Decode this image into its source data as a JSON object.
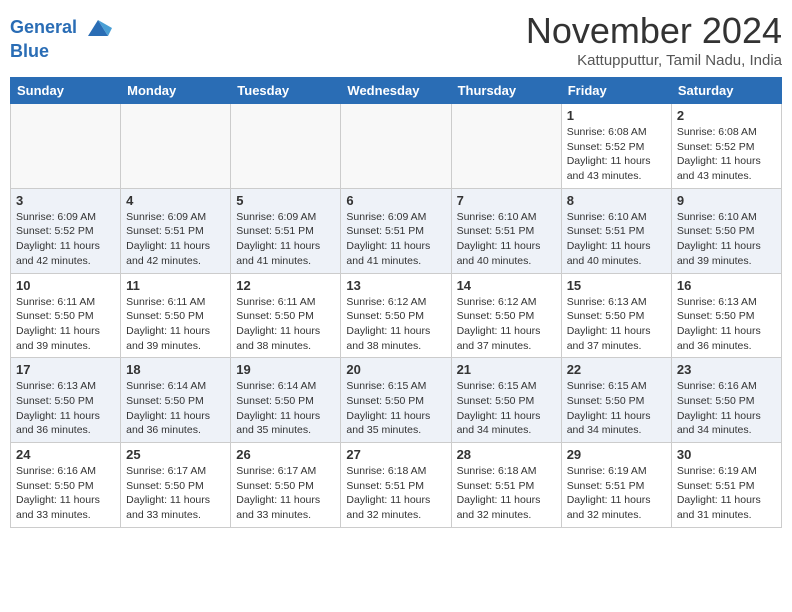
{
  "header": {
    "logo_line1": "General",
    "logo_line2": "Blue",
    "month": "November 2024",
    "location": "Kattupputtur, Tamil Nadu, India"
  },
  "weekdays": [
    "Sunday",
    "Monday",
    "Tuesday",
    "Wednesday",
    "Thursday",
    "Friday",
    "Saturday"
  ],
  "weeks": [
    [
      {
        "day": "",
        "info": ""
      },
      {
        "day": "",
        "info": ""
      },
      {
        "day": "",
        "info": ""
      },
      {
        "day": "",
        "info": ""
      },
      {
        "day": "",
        "info": ""
      },
      {
        "day": "1",
        "info": "Sunrise: 6:08 AM\nSunset: 5:52 PM\nDaylight: 11 hours and 43 minutes."
      },
      {
        "day": "2",
        "info": "Sunrise: 6:08 AM\nSunset: 5:52 PM\nDaylight: 11 hours and 43 minutes."
      }
    ],
    [
      {
        "day": "3",
        "info": "Sunrise: 6:09 AM\nSunset: 5:52 PM\nDaylight: 11 hours and 42 minutes."
      },
      {
        "day": "4",
        "info": "Sunrise: 6:09 AM\nSunset: 5:51 PM\nDaylight: 11 hours and 42 minutes."
      },
      {
        "day": "5",
        "info": "Sunrise: 6:09 AM\nSunset: 5:51 PM\nDaylight: 11 hours and 41 minutes."
      },
      {
        "day": "6",
        "info": "Sunrise: 6:09 AM\nSunset: 5:51 PM\nDaylight: 11 hours and 41 minutes."
      },
      {
        "day": "7",
        "info": "Sunrise: 6:10 AM\nSunset: 5:51 PM\nDaylight: 11 hours and 40 minutes."
      },
      {
        "day": "8",
        "info": "Sunrise: 6:10 AM\nSunset: 5:51 PM\nDaylight: 11 hours and 40 minutes."
      },
      {
        "day": "9",
        "info": "Sunrise: 6:10 AM\nSunset: 5:50 PM\nDaylight: 11 hours and 39 minutes."
      }
    ],
    [
      {
        "day": "10",
        "info": "Sunrise: 6:11 AM\nSunset: 5:50 PM\nDaylight: 11 hours and 39 minutes."
      },
      {
        "day": "11",
        "info": "Sunrise: 6:11 AM\nSunset: 5:50 PM\nDaylight: 11 hours and 39 minutes."
      },
      {
        "day": "12",
        "info": "Sunrise: 6:11 AM\nSunset: 5:50 PM\nDaylight: 11 hours and 38 minutes."
      },
      {
        "day": "13",
        "info": "Sunrise: 6:12 AM\nSunset: 5:50 PM\nDaylight: 11 hours and 38 minutes."
      },
      {
        "day": "14",
        "info": "Sunrise: 6:12 AM\nSunset: 5:50 PM\nDaylight: 11 hours and 37 minutes."
      },
      {
        "day": "15",
        "info": "Sunrise: 6:13 AM\nSunset: 5:50 PM\nDaylight: 11 hours and 37 minutes."
      },
      {
        "day": "16",
        "info": "Sunrise: 6:13 AM\nSunset: 5:50 PM\nDaylight: 11 hours and 36 minutes."
      }
    ],
    [
      {
        "day": "17",
        "info": "Sunrise: 6:13 AM\nSunset: 5:50 PM\nDaylight: 11 hours and 36 minutes."
      },
      {
        "day": "18",
        "info": "Sunrise: 6:14 AM\nSunset: 5:50 PM\nDaylight: 11 hours and 36 minutes."
      },
      {
        "day": "19",
        "info": "Sunrise: 6:14 AM\nSunset: 5:50 PM\nDaylight: 11 hours and 35 minutes."
      },
      {
        "day": "20",
        "info": "Sunrise: 6:15 AM\nSunset: 5:50 PM\nDaylight: 11 hours and 35 minutes."
      },
      {
        "day": "21",
        "info": "Sunrise: 6:15 AM\nSunset: 5:50 PM\nDaylight: 11 hours and 34 minutes."
      },
      {
        "day": "22",
        "info": "Sunrise: 6:15 AM\nSunset: 5:50 PM\nDaylight: 11 hours and 34 minutes."
      },
      {
        "day": "23",
        "info": "Sunrise: 6:16 AM\nSunset: 5:50 PM\nDaylight: 11 hours and 34 minutes."
      }
    ],
    [
      {
        "day": "24",
        "info": "Sunrise: 6:16 AM\nSunset: 5:50 PM\nDaylight: 11 hours and 33 minutes."
      },
      {
        "day": "25",
        "info": "Sunrise: 6:17 AM\nSunset: 5:50 PM\nDaylight: 11 hours and 33 minutes."
      },
      {
        "day": "26",
        "info": "Sunrise: 6:17 AM\nSunset: 5:50 PM\nDaylight: 11 hours and 33 minutes."
      },
      {
        "day": "27",
        "info": "Sunrise: 6:18 AM\nSunset: 5:51 PM\nDaylight: 11 hours and 32 minutes."
      },
      {
        "day": "28",
        "info": "Sunrise: 6:18 AM\nSunset: 5:51 PM\nDaylight: 11 hours and 32 minutes."
      },
      {
        "day": "29",
        "info": "Sunrise: 6:19 AM\nSunset: 5:51 PM\nDaylight: 11 hours and 32 minutes."
      },
      {
        "day": "30",
        "info": "Sunrise: 6:19 AM\nSunset: 5:51 PM\nDaylight: 11 hours and 31 minutes."
      }
    ]
  ]
}
